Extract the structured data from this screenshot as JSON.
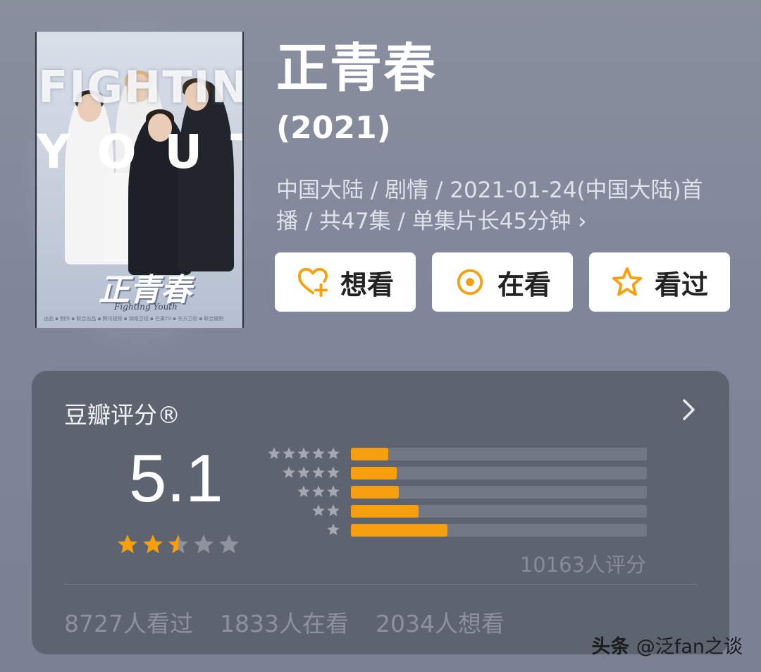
{
  "poster": {
    "word1": "FIGHTING",
    "word2": "YOUTH",
    "title_cn": "正青春",
    "title_en": "Fighting Youth",
    "credits": "出品 ▪ 制作 ▪ 联合出品 ▪ 腾讯视频 ▪ 湖南卫视 ▪ 芒果TV ▪ 东方卫视 ▪ 联合摄制"
  },
  "title": "正青春",
  "year": "(2021)",
  "meta": "中国大陆 / 剧情 / 2021-01-24(中国大陆)首播 / 共47集 / 单集片长45分钟",
  "meta_chevron": "›",
  "buttons": {
    "want": "想看",
    "watching": "在看",
    "watched": "看过"
  },
  "rating": {
    "heading": "豆瓣评分®",
    "score": "5.1",
    "star_value": 2.5,
    "distribution_fraction": [
      0.125,
      0.155,
      0.162,
      0.228,
      0.325
    ],
    "votes": "10163人评分"
  },
  "counts": {
    "watched": "8727人看过",
    "watching": "1833人在看",
    "want": "2034人想看"
  },
  "watermark": {
    "brand": "头条",
    "handle": "@泛fan之谈"
  },
  "colors": {
    "accent": "#f6a00f",
    "card_bg": "#5e6370",
    "bar_track": "#737885"
  }
}
